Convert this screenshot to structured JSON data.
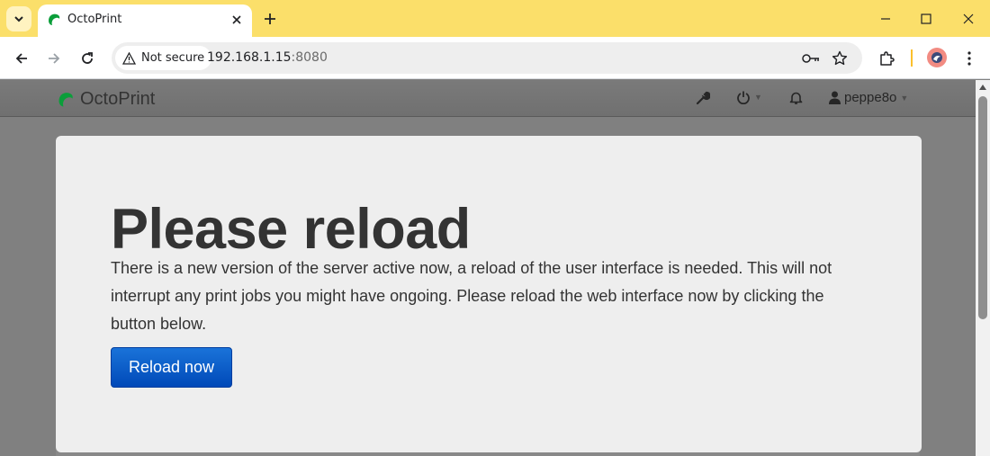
{
  "browser": {
    "tab": {
      "title": "OctoPrint"
    },
    "address": {
      "security_label": "Not secure",
      "host": "192.168.1.15",
      "port": ":8080"
    }
  },
  "navbar": {
    "brand": "OctoPrint",
    "user": "peppe8o"
  },
  "modal": {
    "title": "Please reload",
    "body": "There is a new version of the server active now, a reload of the user interface is needed. This will not interrupt any print jobs you might have ongoing. Please reload the web interface now by clicking the button below.",
    "button_label": "Reload now"
  },
  "colors": {
    "tabbar": "#fbdf6a",
    "button": "#0a5fcc",
    "brand_green": "#0b9e3a"
  }
}
